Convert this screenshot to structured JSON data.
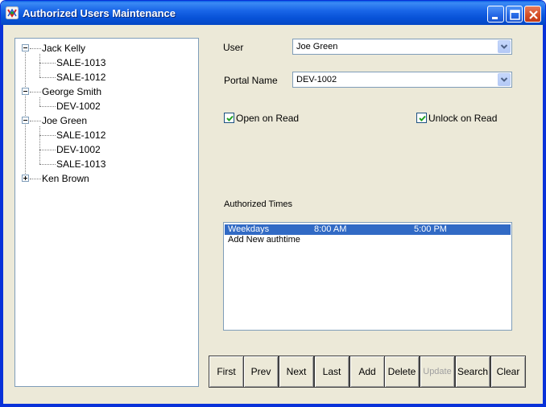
{
  "window": {
    "title": "Authorized Users Maintenance",
    "app_icon": "mixer-icon"
  },
  "tree": {
    "nodes": [
      {
        "label": "Jack Kelly",
        "expanded": true,
        "children": [
          "SALE-1013",
          "SALE-1012"
        ]
      },
      {
        "label": "George Smith",
        "expanded": true,
        "children": [
          "DEV-1002"
        ]
      },
      {
        "label": "Joe Green",
        "expanded": true,
        "children": [
          "SALE-1012",
          "DEV-1002",
          "SALE-1013"
        ]
      },
      {
        "label": "Ken Brown",
        "expanded": false,
        "children": []
      }
    ]
  },
  "form": {
    "user_label": "User",
    "user_value": "Joe Green",
    "portal_label": "Portal Name",
    "portal_value": "DEV-1002",
    "open_on_read_label": "Open on Read",
    "open_on_read_checked": true,
    "unlock_on_read_label": "Unlock on Read",
    "unlock_on_read_checked": true,
    "authorized_times_label": "Authorized Times"
  },
  "authorized_times": {
    "rows": [
      {
        "day": "Weekdays",
        "start": "8:00 AM",
        "end": "5:00 PM",
        "selected": true
      },
      {
        "day": "Add New authtime",
        "start": "",
        "end": "",
        "selected": false
      }
    ]
  },
  "buttons": {
    "first": "First",
    "prev": "Prev",
    "next": "Next",
    "last": "Last",
    "add": "Add",
    "delete": "Delete",
    "update": "Update",
    "search": "Search",
    "clear": "Clear"
  },
  "colors": {
    "titlebar": "#0853d8",
    "selection": "#316ac5",
    "window_bg": "#ece9d8"
  }
}
